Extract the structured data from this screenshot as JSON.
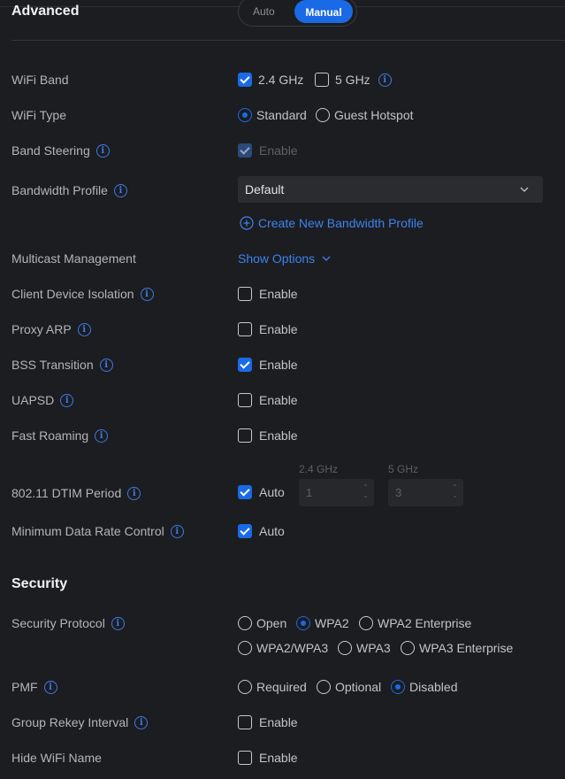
{
  "header": {
    "title": "Advanced",
    "mode_options": [
      "Auto",
      "Manual"
    ],
    "mode_selected": "Manual"
  },
  "rows": {
    "wifi_band": {
      "label": "WiFi Band",
      "opt_24": "2.4 GHz",
      "opt_5": "5 GHz"
    },
    "wifi_type": {
      "label": "WiFi Type",
      "opt_standard": "Standard",
      "opt_guest": "Guest Hotspot"
    },
    "band_steering": {
      "label": "Band Steering",
      "enable": "Enable"
    },
    "bandwidth_profile": {
      "label": "Bandwidth Profile",
      "value": "Default",
      "create_link": "Create New Bandwidth Profile"
    },
    "multicast": {
      "label": "Multicast Management",
      "link": "Show Options"
    },
    "client_isolation": {
      "label": "Client Device Isolation",
      "enable": "Enable"
    },
    "proxy_arp": {
      "label": "Proxy ARP",
      "enable": "Enable"
    },
    "bss_transition": {
      "label": "BSS Transition",
      "enable": "Enable"
    },
    "uapsd": {
      "label": "UAPSD",
      "enable": "Enable"
    },
    "fast_roaming": {
      "label": "Fast Roaming",
      "enable": "Enable"
    },
    "dtim": {
      "label": "802.11 DTIM Period",
      "auto": "Auto",
      "band_24_label": "2.4 GHz",
      "band_5_label": "5 GHz",
      "value_24": "1",
      "value_5": "3"
    },
    "min_rate": {
      "label": "Minimum Data Rate Control",
      "auto": "Auto"
    }
  },
  "security": {
    "title": "Security",
    "protocol": {
      "label": "Security Protocol",
      "options": [
        "Open",
        "WPA2",
        "WPA2 Enterprise",
        "WPA2/WPA3",
        "WPA3",
        "WPA3 Enterprise"
      ],
      "selected": "WPA2"
    },
    "pmf": {
      "label": "PMF",
      "options": [
        "Required",
        "Optional",
        "Disabled"
      ],
      "selected": "Disabled"
    },
    "group_rekey": {
      "label": "Group Rekey Interval",
      "enable": "Enable"
    },
    "hide_name": {
      "label": "Hide WiFi Name",
      "enable": "Enable"
    }
  },
  "colors": {
    "accent": "#1a6ae6",
    "background": "#1c1d20",
    "link": "#3d82f0"
  },
  "icons": [
    "info-icon",
    "chevron-down-icon",
    "plus-circle-icon",
    "check-icon"
  ]
}
